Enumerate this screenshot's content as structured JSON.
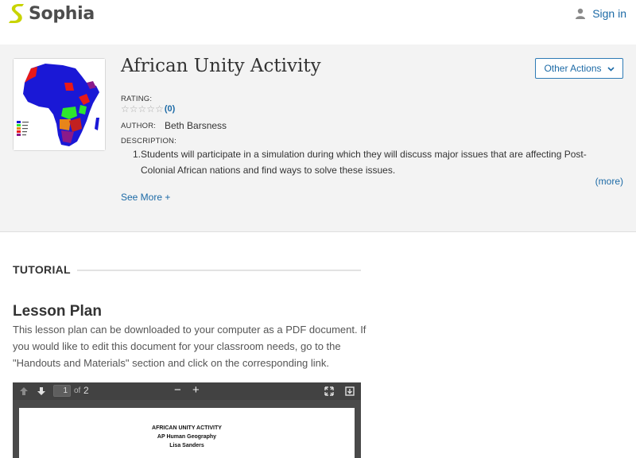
{
  "header": {
    "logo_text": "Sophia",
    "signin_label": "Sign in",
    "brand_color": "#c8d400",
    "link_color": "#1c6aa6"
  },
  "resource": {
    "title": "African Unity Activity",
    "other_actions_label": "Other Actions",
    "rating_label": "RATING:",
    "rating_stars": 0,
    "rating_count": "(0)",
    "author_label": "AUTHOR:",
    "author_name": "Beth Barsness",
    "description_label": "DESCRIPTION:",
    "description_number": "1.",
    "description_text": "Students will participate in a simulation during which they will discuss major issues that are affecting Post-Colonial African nations and find ways to solve these issues.",
    "more_label": "(more)",
    "see_more_label": "See More +"
  },
  "tutorial": {
    "section_label": "TUTORIAL",
    "lesson_title": "Lesson Plan",
    "lesson_body": "This lesson plan can be downloaded to your computer as a PDF document. If you would like to edit this document for your classroom needs, go to the \"Handouts and Materials\" section and click on the corresponding link."
  },
  "pdf_viewer": {
    "current_page": "1",
    "of_label": "of",
    "total_pages": "2",
    "zoom_out": "−",
    "zoom_in": "+",
    "doc_title": "AFRICAN UNITY ACTIVITY",
    "doc_subtitle": "AP Human Geography",
    "doc_author": "Lisa Sanders"
  },
  "icons": [
    "sophia-logo-icon",
    "user-icon",
    "chevron-down-icon",
    "star-icon",
    "arrow-up-icon",
    "arrow-down-icon",
    "fullscreen-icon",
    "download-icon"
  ]
}
